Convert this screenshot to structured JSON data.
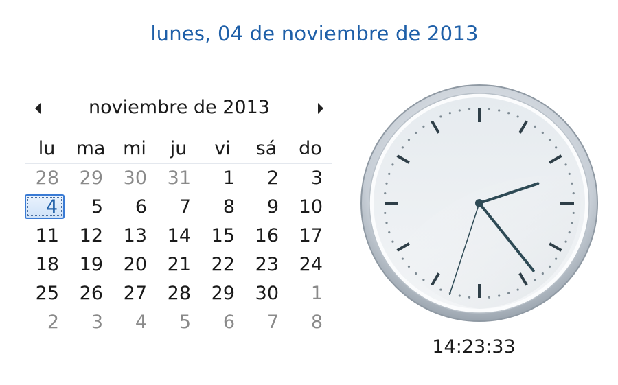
{
  "header": {
    "full_date": "lunes, 04 de noviembre de 2013"
  },
  "calendar": {
    "month_label": "noviembre de 2013",
    "prev_icon": "triangle-left-icon",
    "next_icon": "triangle-right-icon",
    "weekdays": [
      "lu",
      "ma",
      "mi",
      "ju",
      "vi",
      "sá",
      "do"
    ],
    "weeks": [
      [
        {
          "d": "28",
          "other": true
        },
        {
          "d": "29",
          "other": true
        },
        {
          "d": "30",
          "other": true
        },
        {
          "d": "31",
          "other": true
        },
        {
          "d": "1"
        },
        {
          "d": "2"
        },
        {
          "d": "3"
        }
      ],
      [
        {
          "d": "4",
          "today": true
        },
        {
          "d": "5"
        },
        {
          "d": "6"
        },
        {
          "d": "7"
        },
        {
          "d": "8"
        },
        {
          "d": "9"
        },
        {
          "d": "10"
        }
      ],
      [
        {
          "d": "11"
        },
        {
          "d": "12"
        },
        {
          "d": "13"
        },
        {
          "d": "14"
        },
        {
          "d": "15"
        },
        {
          "d": "16"
        },
        {
          "d": "17"
        }
      ],
      [
        {
          "d": "18"
        },
        {
          "d": "19"
        },
        {
          "d": "20"
        },
        {
          "d": "21"
        },
        {
          "d": "22"
        },
        {
          "d": "23"
        },
        {
          "d": "24"
        }
      ],
      [
        {
          "d": "25"
        },
        {
          "d": "26"
        },
        {
          "d": "27"
        },
        {
          "d": "28"
        },
        {
          "d": "29"
        },
        {
          "d": "30"
        },
        {
          "d": "1",
          "other": true
        }
      ],
      [
        {
          "d": "2",
          "other": true
        },
        {
          "d": "3",
          "other": true
        },
        {
          "d": "4",
          "other": true
        },
        {
          "d": "5",
          "other": true
        },
        {
          "d": "6",
          "other": true
        },
        {
          "d": "7",
          "other": true
        },
        {
          "d": "8",
          "other": true
        }
      ]
    ]
  },
  "clock": {
    "time_text": "14:23:33",
    "hour": 14,
    "minute": 23,
    "second": 33
  },
  "colors": {
    "accent": "#1e5fa8",
    "today_border": "#3a7bd5",
    "other_month_text": "#8a8a8a",
    "clock_hand": "#2e4a55"
  }
}
